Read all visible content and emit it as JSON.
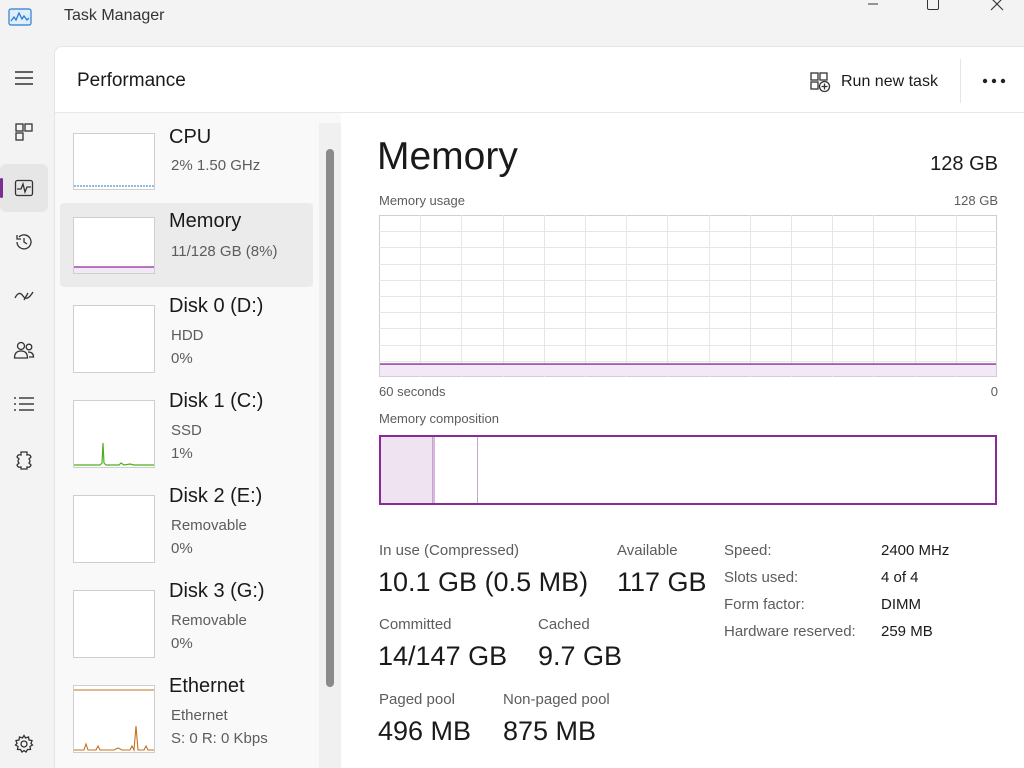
{
  "window": {
    "title": "Task Manager",
    "controls": [
      "minimize-icon",
      "maximize-icon",
      "close-icon"
    ]
  },
  "nav": {
    "items": [
      {
        "icon": "hamburger-icon",
        "active": false
      },
      {
        "icon": "processes-icon",
        "active": false
      },
      {
        "icon": "performance-icon",
        "active": true
      },
      {
        "icon": "app-history-icon",
        "active": false
      },
      {
        "icon": "startup-apps-icon",
        "active": false
      },
      {
        "icon": "users-icon",
        "active": false
      },
      {
        "icon": "details-icon",
        "active": false
      },
      {
        "icon": "services-icon",
        "active": false
      },
      {
        "icon": "settings-icon",
        "active": false
      }
    ]
  },
  "header": {
    "title": "Performance",
    "run_task_label": "Run new task",
    "more_icon": "more-icon"
  },
  "devices": [
    {
      "name": "CPU",
      "line1": "2%  1.50 GHz",
      "line2": "",
      "selected": false,
      "graph_color": "#1f7ac4"
    },
    {
      "name": "Memory",
      "line1": "11/128 GB (8%)",
      "line2": "",
      "selected": true,
      "graph_color": "#8a2a99"
    },
    {
      "name": "Disk 0 (D:)",
      "line1": "HDD",
      "line2": "0%",
      "selected": false,
      "graph_color": "#4caf1f"
    },
    {
      "name": "Disk 1 (C:)",
      "line1": "SSD",
      "line2": "1%",
      "selected": false,
      "graph_color": "#4caf1f"
    },
    {
      "name": "Disk 2 (E:)",
      "line1": "Removable",
      "line2": "0%",
      "selected": false,
      "graph_color": "#4caf1f"
    },
    {
      "name": "Disk 3 (G:)",
      "line1": "Removable",
      "line2": "0%",
      "selected": false,
      "graph_color": "#4caf1f"
    },
    {
      "name": "Ethernet",
      "line1": "Ethernet",
      "line2": "S: 0  R: 0 Kbps",
      "selected": false,
      "graph_color": "#c4701f"
    }
  ],
  "memory": {
    "title": "Memory",
    "total": "128 GB",
    "usage_label": "Memory usage",
    "usage_max": "128 GB",
    "time_left": "60 seconds",
    "time_right": "0",
    "usage_fraction": 0.08,
    "composition_label": "Memory composition",
    "composition": {
      "in_use_fraction": 0.085,
      "modified_fraction": 0.004,
      "standby_fraction": 0.07
    },
    "accent": "#8a2a99",
    "stats": {
      "in_use_label": "In use (Compressed)",
      "in_use_value": "10.1 GB (0.5 MB)",
      "available_label": "Available",
      "available_value": "117 GB",
      "committed_label": "Committed",
      "committed_value": "14/147 GB",
      "cached_label": "Cached",
      "cached_value": "9.7 GB",
      "paged_label": "Paged pool",
      "paged_value": "496 MB",
      "nonpaged_label": "Non-paged pool",
      "nonpaged_value": "875 MB"
    },
    "specs": [
      {
        "key": "Speed:",
        "value": "2400 MHz"
      },
      {
        "key": "Slots used:",
        "value": "4 of 4"
      },
      {
        "key": "Form factor:",
        "value": "DIMM"
      },
      {
        "key": "Hardware reserved:",
        "value": "259 MB"
      }
    ]
  }
}
